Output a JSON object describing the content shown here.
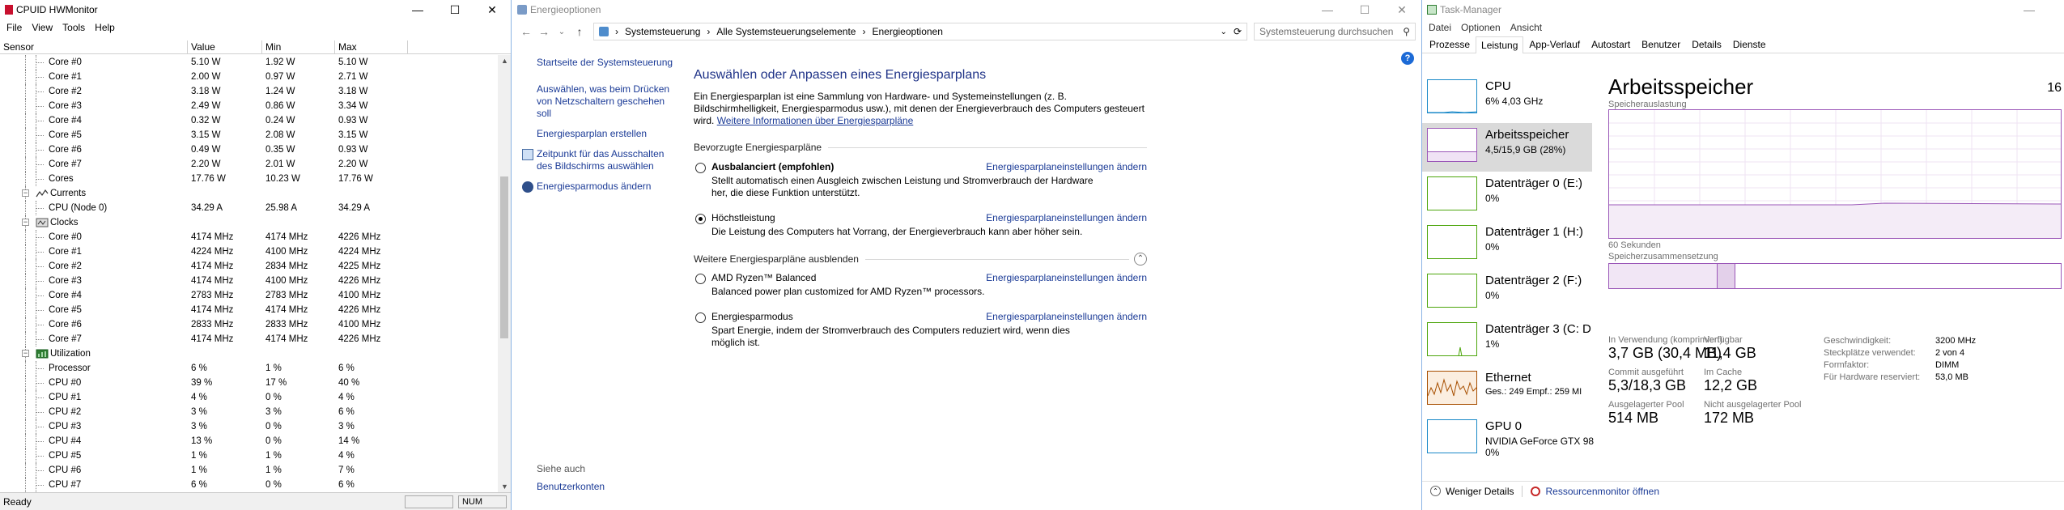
{
  "hwmonitor": {
    "title": "CPUID HWMonitor",
    "menu": [
      "File",
      "View",
      "Tools",
      "Help"
    ],
    "columns": [
      "Sensor",
      "Value",
      "Min",
      "Max"
    ],
    "rows": [
      {
        "label": "Core #0",
        "value": "5.10 W",
        "min": "1.92 W",
        "max": "5.10 W",
        "level": 3
      },
      {
        "label": "Core #1",
        "value": "2.00 W",
        "min": "0.97 W",
        "max": "2.71 W",
        "level": 3
      },
      {
        "label": "Core #2",
        "value": "3.18 W",
        "min": "1.24 W",
        "max": "3.18 W",
        "level": 3
      },
      {
        "label": "Core #3",
        "value": "2.49 W",
        "min": "0.86 W",
        "max": "3.34 W",
        "level": 3
      },
      {
        "label": "Core #4",
        "value": "0.32 W",
        "min": "0.24 W",
        "max": "0.93 W",
        "level": 3
      },
      {
        "label": "Core #5",
        "value": "3.15 W",
        "min": "2.08 W",
        "max": "3.15 W",
        "level": 3
      },
      {
        "label": "Core #6",
        "value": "0.49 W",
        "min": "0.35 W",
        "max": "0.93 W",
        "level": 3
      },
      {
        "label": "Core #7",
        "value": "2.20 W",
        "min": "2.01 W",
        "max": "2.20 W",
        "level": 3
      },
      {
        "label": "Cores",
        "value": "17.76 W",
        "min": "10.23 W",
        "max": "17.76 W",
        "level": 3
      },
      {
        "label": "Currents",
        "value": "",
        "min": "",
        "max": "",
        "level": 2,
        "category": true,
        "icon": "currents-icon"
      },
      {
        "label": "CPU (Node 0)",
        "value": "34.29 A",
        "min": "25.98 A",
        "max": "34.29 A",
        "level": 3
      },
      {
        "label": "Clocks",
        "value": "",
        "min": "",
        "max": "",
        "level": 2,
        "category": true,
        "icon": "clocks-icon"
      },
      {
        "label": "Core #0",
        "value": "4174 MHz",
        "min": "4174 MHz",
        "max": "4226 MHz",
        "level": 3
      },
      {
        "label": "Core #1",
        "value": "4224 MHz",
        "min": "4100 MHz",
        "max": "4224 MHz",
        "level": 3
      },
      {
        "label": "Core #2",
        "value": "4174 MHz",
        "min": "2834 MHz",
        "max": "4225 MHz",
        "level": 3
      },
      {
        "label": "Core #3",
        "value": "4174 MHz",
        "min": "4100 MHz",
        "max": "4226 MHz",
        "level": 3
      },
      {
        "label": "Core #4",
        "value": "2783 MHz",
        "min": "2783 MHz",
        "max": "4100 MHz",
        "level": 3
      },
      {
        "label": "Core #5",
        "value": "4174 MHz",
        "min": "4174 MHz",
        "max": "4226 MHz",
        "level": 3
      },
      {
        "label": "Core #6",
        "value": "2833 MHz",
        "min": "2833 MHz",
        "max": "4100 MHz",
        "level": 3
      },
      {
        "label": "Core #7",
        "value": "4174 MHz",
        "min": "4174 MHz",
        "max": "4226 MHz",
        "level": 3
      },
      {
        "label": "Utilization",
        "value": "",
        "min": "",
        "max": "",
        "level": 2,
        "category": true,
        "icon": "utilization-icon"
      },
      {
        "label": "Processor",
        "value": "6 %",
        "min": "1 %",
        "max": "6 %",
        "level": 3
      },
      {
        "label": "CPU #0",
        "value": "39 %",
        "min": "17 %",
        "max": "40 %",
        "level": 3
      },
      {
        "label": "CPU #1",
        "value": "4 %",
        "min": "0 %",
        "max": "4 %",
        "level": 3
      },
      {
        "label": "CPU #2",
        "value": "3 %",
        "min": "3 %",
        "max": "6 %",
        "level": 3
      },
      {
        "label": "CPU #3",
        "value": "3 %",
        "min": "0 %",
        "max": "3 %",
        "level": 3
      },
      {
        "label": "CPU #4",
        "value": "13 %",
        "min": "0 %",
        "max": "14 %",
        "level": 3
      },
      {
        "label": "CPU #5",
        "value": "1 %",
        "min": "1 %",
        "max": "4 %",
        "level": 3
      },
      {
        "label": "CPU #6",
        "value": "1 %",
        "min": "1 %",
        "max": "7 %",
        "level": 3
      },
      {
        "label": "CPU #7",
        "value": "6 %",
        "min": "0 %",
        "max": "6 %",
        "level": 3
      }
    ],
    "status": "Ready",
    "status_num": "NUM"
  },
  "energy": {
    "title": "Energieoptionen",
    "breadcrumb": [
      "Systemsteuerung",
      "Alle Systemsteuerungselemente",
      "Energieoptionen"
    ],
    "search_placeholder": "Systemsteuerung durchsuchen",
    "left_links": [
      "Startseite der Systemsteuerung",
      "Auswählen, was beim Drücken von Netzschaltern geschehen soll",
      "Energiesparplan erstellen",
      "Zeitpunkt für das Ausschalten des Bildschirms auswählen",
      "Energiesparmodus ändern"
    ],
    "see_also": "Siehe auch",
    "user_accounts": "Benutzerkonten",
    "heading": "Auswählen oder Anpassen eines Energiesparplans",
    "description": "Ein Energiesparplan ist eine Sammlung von Hardware- und Systemeinstellungen (z. B. Bildschirmhelligkeit, Energiesparmodus usw.), mit denen der Energieverbrauch des Computers gesteuert wird.",
    "description_link": "Weitere Informationen über Energiesparpläne",
    "preferred_section": "Bevorzugte Energiesparpläne",
    "more_section": "Weitere Energiesparpläne ausblenden",
    "change_link": "Energiesparplaneinstellungen ändern",
    "plans_preferred": [
      {
        "name": "Ausbalanciert (empfohlen)",
        "desc": "Stellt automatisch einen Ausgleich zwischen Leistung und Stromverbrauch der Hardware her, die diese Funktion unterstützt.",
        "selected": false,
        "bold": true
      },
      {
        "name": "Höchstleistung",
        "desc": "Die Leistung des Computers hat Vorrang, der Energieverbrauch kann aber höher sein.",
        "selected": true,
        "bold": false
      }
    ],
    "plans_more": [
      {
        "name": "AMD Ryzen™ Balanced",
        "desc": "Balanced power plan customized for AMD Ryzen™ processors.",
        "selected": false
      },
      {
        "name": "Energiesparmodus",
        "desc": "Spart Energie, indem der Stromverbrauch des Computers reduziert wird, wenn dies möglich ist.",
        "selected": false
      }
    ]
  },
  "taskmanager": {
    "title": "Task-Manager",
    "menu": [
      "Datei",
      "Optionen",
      "Ansicht"
    ],
    "tabs": [
      "Prozesse",
      "Leistung",
      "App-Verlauf",
      "Autostart",
      "Benutzer",
      "Details",
      "Dienste"
    ],
    "active_tab": "Leistung",
    "side": [
      {
        "name": "CPU",
        "sub": "6% 4,03 GHz",
        "sub2": ""
      },
      {
        "name": "Arbeitsspeicher",
        "sub": "4,5/15,9 GB (28%)",
        "sub2": ""
      },
      {
        "name": "Datenträger 0 (E:)",
        "sub": "0%",
        "sub2": ""
      },
      {
        "name": "Datenträger 1 (H:)",
        "sub": "0%",
        "sub2": ""
      },
      {
        "name": "Datenträger 2 (F:)",
        "sub": "0%",
        "sub2": ""
      },
      {
        "name": "Datenträger 3 (C: D",
        "sub": "1%",
        "sub2": ""
      },
      {
        "name": "Ethernet",
        "sub": "Ges.: 249 Empf.: 259 MI",
        "sub2": ""
      },
      {
        "name": "GPU 0",
        "sub": "NVIDIA GeForce GTX 98",
        "sub2": "0%"
      }
    ],
    "heading": "Arbeitsspeicher",
    "heading_right": "16",
    "usage_label": "Speicherauslastung",
    "seconds_label": "60 Sekunden",
    "composition_label": "Speicherzusammensetzung",
    "stats": [
      {
        "label": "In Verwendung (komprimiert)",
        "value": "3,7 GB (30,4 MB)"
      },
      {
        "label": "Verfügbar",
        "value": "11,4 GB"
      },
      {
        "label": "Commit ausgeführt",
        "value": "5,3/18,3 GB"
      },
      {
        "label": "Im Cache",
        "value": "12,2 GB"
      },
      {
        "label": "Ausgelagerter Pool",
        "value": "514 MB"
      },
      {
        "label": "Nicht ausgelagerter Pool",
        "value": "172 MB"
      }
    ],
    "props": [
      {
        "k": "Geschwindigkeit:",
        "v": "3200 MHz"
      },
      {
        "k": "Steckplätze verwendet:",
        "v": "2 von 4"
      },
      {
        "k": "Formfaktor:",
        "v": "DIMM"
      },
      {
        "k": "Für Hardware reserviert:",
        "v": "53,0 MB"
      }
    ],
    "footer_less": "Weniger Details",
    "footer_resmon": "Ressourcenmonitor öffnen"
  }
}
